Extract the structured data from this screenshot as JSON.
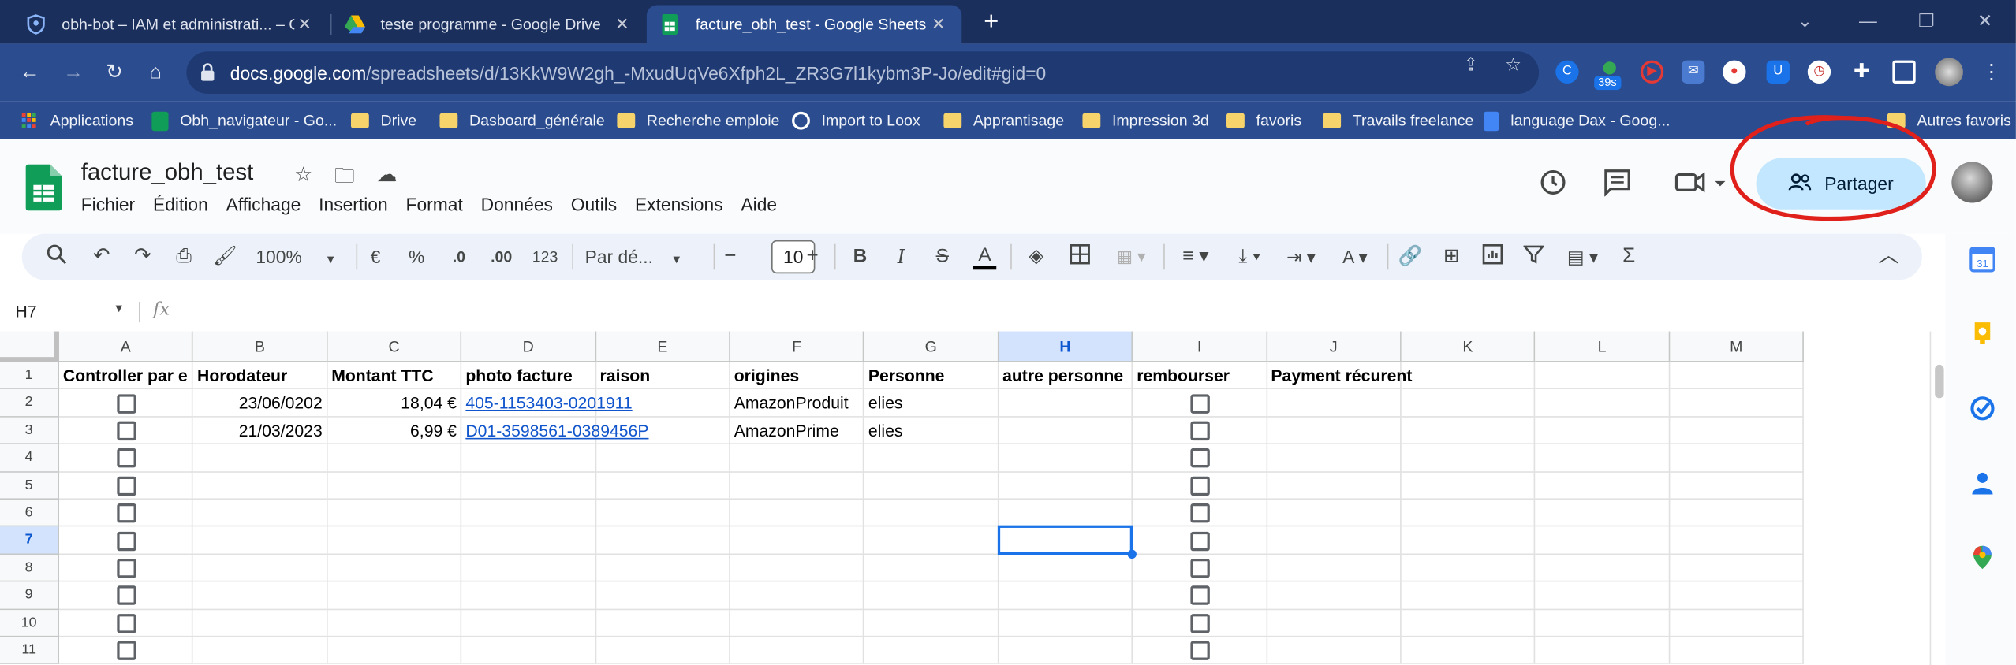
{
  "tabs": [
    {
      "title": "obh-bot – IAM et administrati... – O",
      "favicon": "shield-icon"
    },
    {
      "title": "teste programme - Google Drive",
      "favicon": "drive-icon"
    },
    {
      "title": "facture_obh_test - Google Sheets",
      "favicon": "sheets-icon"
    }
  ],
  "address": {
    "host": "docs.google.com",
    "path": "/spreadsheets/d/13KkW9W2gh_-MxudUqVe6Xfph2L_ZR3G7l1kybm3P-Jo/edit#gid=0"
  },
  "extension_badge": "39s",
  "bookmarks": [
    "Applications",
    "Obh_navigateur - Go...",
    "Drive",
    "Dasboard_générale",
    "Recherche emploie",
    "Import to Loox",
    "Apprantisage",
    "Impression 3d",
    "favoris",
    "Travails freelance",
    "language Dax - Goog...",
    "Autres favoris"
  ],
  "doc": {
    "title": "facture_obh_test",
    "menu": [
      "Fichier",
      "Édition",
      "Affichage",
      "Insertion",
      "Format",
      "Données",
      "Outils",
      "Extensions",
      "Aide"
    ],
    "share_label": "Partager"
  },
  "toolbar": {
    "zoom": "100%",
    "currency": "€",
    "percent": "%",
    "dec_less": ".0",
    "dec_more": ".00",
    "number_format": "123",
    "font": "Par dé...",
    "font_size": "10"
  },
  "formula_bar": {
    "name_box": "H7",
    "fx": "fx",
    "content": ""
  },
  "grid": {
    "columns": [
      "A",
      "B",
      "C",
      "D",
      "E",
      "F",
      "G",
      "H",
      "I",
      "J",
      "K",
      "L",
      "M"
    ],
    "selected_column": "H",
    "selected_row": "7",
    "rows": [
      "1",
      "2",
      "3",
      "4",
      "5",
      "6",
      "7",
      "8",
      "9",
      "10",
      "11"
    ],
    "headers": [
      "Controller par e",
      "Horodateur",
      "Montant TTC",
      "photo facture",
      "raison",
      "origines",
      "Personne",
      "autre personne",
      "rembourser",
      "Payment récurent"
    ],
    "data": [
      {
        "horodateur": "23/06/0202",
        "montant": "18,04 €",
        "photo": "405-1153403-0201911",
        "origine": "AmazonProduit",
        "personne": "elies"
      },
      {
        "horodateur": "21/03/2023",
        "montant": "6,99 €",
        "photo": "D01-3598561-0389456P",
        "origine": "AmazonPrime",
        "personne": "elies"
      }
    ]
  },
  "colors": {
    "chrome_dark": "#1a2f5c",
    "chrome": "#2b4c8f",
    "share": "#c2e7ff",
    "selection": "#1a73e8",
    "link": "#1155cc",
    "annotation": "#e0201b"
  }
}
